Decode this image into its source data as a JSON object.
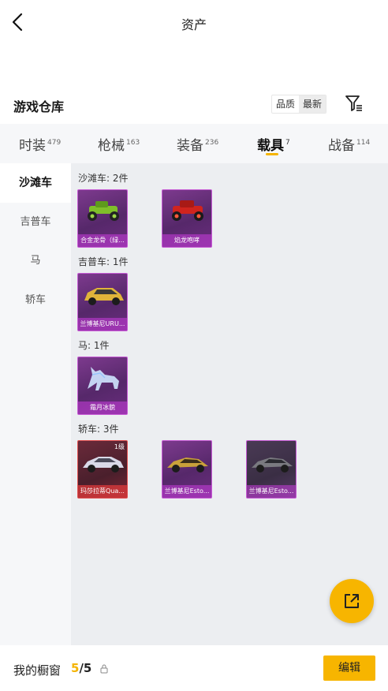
{
  "header": {
    "title": "资产",
    "back_icon": "chevron-left-icon"
  },
  "warehouse": {
    "title": "游戏仓库",
    "sort_options": [
      "品质",
      "最新"
    ],
    "sort_selected": "最新",
    "filter_icon": "filter-icon"
  },
  "tabs": [
    {
      "label": "时装",
      "count": "479"
    },
    {
      "label": "枪械",
      "count": "163"
    },
    {
      "label": "装备",
      "count": "236"
    },
    {
      "label": "载具",
      "count": "7"
    },
    {
      "label": "战备",
      "count": "114"
    }
  ],
  "active_tab": "载具",
  "categories": [
    "沙滩车",
    "吉普车",
    "马",
    "轿车"
  ],
  "active_category": "沙滩车",
  "sections": [
    {
      "label": "沙滩车: 2件",
      "items": [
        {
          "name": "合金龙骨（绿...",
          "level": ""
        },
        {
          "name": "焰龙咆哮",
          "level": ""
        }
      ]
    },
    {
      "label": "吉普车: 1件",
      "items": [
        {
          "name": "兰博基尼URU...",
          "level": ""
        }
      ]
    },
    {
      "label": "马: 1件",
      "items": [
        {
          "name": "霜月冰貌",
          "level": ""
        }
      ]
    },
    {
      "label": "轿车: 3件",
      "items": [
        {
          "name": "玛莎拉蒂Qua...",
          "level": "1级"
        },
        {
          "name": "兰博基尼Esto...",
          "level": ""
        },
        {
          "name": "兰博基尼Esto...",
          "level": ""
        }
      ]
    }
  ],
  "showcase": {
    "label": "我的橱窗",
    "current": "5",
    "separator": "/",
    "total": "5",
    "edit_label": "编辑"
  },
  "colors": {
    "accent": "#f5b400",
    "card_purple": "#7d3a8e",
    "card_red": "#e05050"
  }
}
